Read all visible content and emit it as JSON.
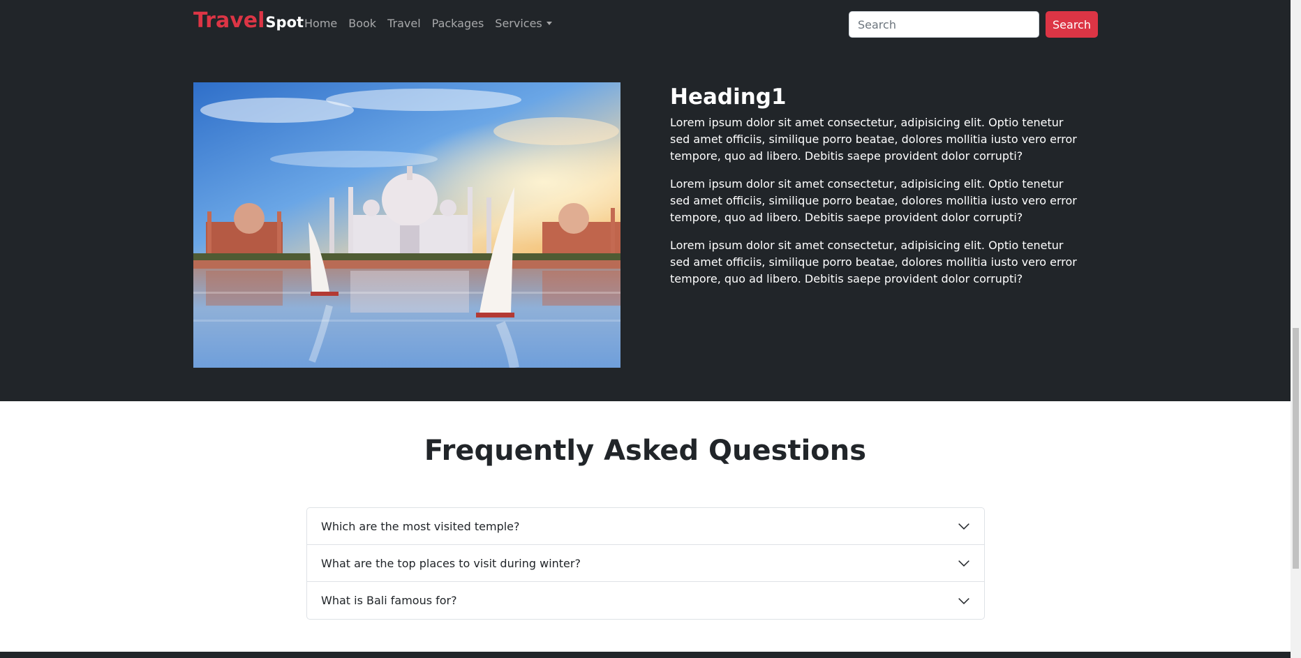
{
  "navbar": {
    "brand_primary": "Travel",
    "brand_secondary": "Spot",
    "links": [
      "Home",
      "Book",
      "Travel",
      "Packages",
      "Services"
    ],
    "search_placeholder": "Search",
    "search_button": "Search"
  },
  "hero": {
    "heading": "Heading1",
    "paragraphs": [
      "Lorem ipsum dolor sit amet consectetur, adipisicing elit. Optio tenetur sed amet officiis, similique porro beatae, dolores mollitia iusto vero error tempore, quo ad libero. Debitis saepe provident dolor corrupti?",
      "Lorem ipsum dolor sit amet consectetur, adipisicing elit. Optio tenetur sed amet officiis, similique porro beatae, dolores mollitia iusto vero error tempore, quo ad libero. Debitis saepe provident dolor corrupti?",
      "Lorem ipsum dolor sit amet consectetur, adipisicing elit. Optio tenetur sed amet officiis, similique porro beatae, dolores mollitia iusto vero error tempore, quo ad libero. Debitis saepe provident dolor corrupti?"
    ],
    "image_icon": "taj-mahal-image"
  },
  "faq": {
    "title": "Frequently Asked Questions",
    "questions": [
      "Which are the most visited temple?",
      "What are the top places to visit during winter?",
      "What is Bali famous for?"
    ]
  },
  "colors": {
    "dark": "#212529",
    "accent": "#dc3545"
  }
}
